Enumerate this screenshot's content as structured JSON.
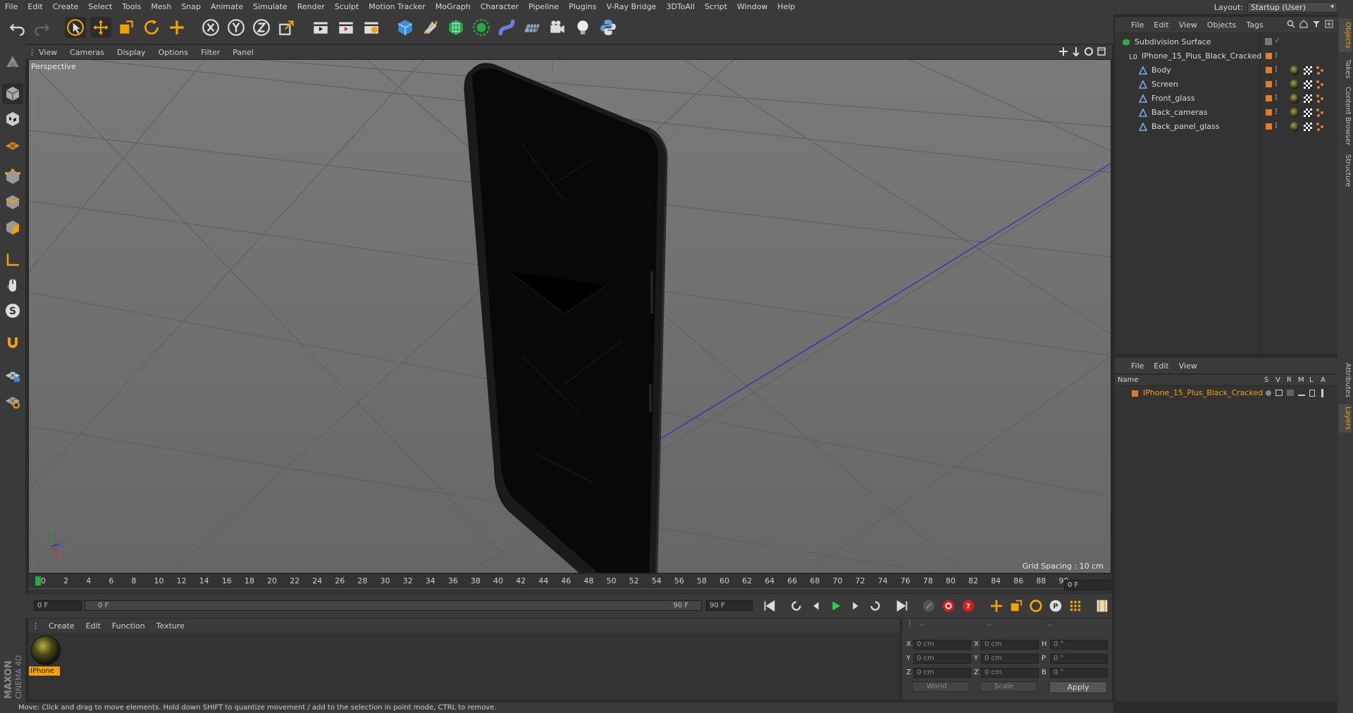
{
  "menubar": {
    "items": [
      "File",
      "Edit",
      "Create",
      "Select",
      "Tools",
      "Mesh",
      "Snap",
      "Animate",
      "Simulate",
      "Render",
      "Sculpt",
      "Motion Tracker",
      "MoGraph",
      "Character",
      "Pipeline",
      "Plugins",
      "V-Ray Bridge",
      "3DToAll",
      "Script",
      "Window",
      "Help"
    ],
    "layout_label": "Layout:",
    "layout_value": "Startup (User)"
  },
  "viewport": {
    "menu": [
      "View",
      "Cameras",
      "Display",
      "Options",
      "Filter",
      "Panel"
    ],
    "label": "Perspective",
    "grid_spacing": "Grid Spacing : 10 cm",
    "axis_y": "Y",
    "axis_z": "Z",
    "axis_x": "X"
  },
  "timeline": {
    "ticks": [
      "0",
      "2",
      "4",
      "6",
      "8",
      "10",
      "12",
      "14",
      "16",
      "18",
      "20",
      "22",
      "24",
      "26",
      "28",
      "30",
      "32",
      "34",
      "36",
      "38",
      "40",
      "42",
      "44",
      "46",
      "48",
      "50",
      "52",
      "54",
      "56",
      "58",
      "60",
      "62",
      "64",
      "66",
      "68",
      "70",
      "72",
      "74",
      "76",
      "78",
      "80",
      "82",
      "84",
      "86",
      "88",
      "90"
    ],
    "current_frame": "0 F"
  },
  "transport": {
    "start_field": "0 F",
    "range_start": "0 F",
    "range_end": "90 F",
    "end_field": "90 F"
  },
  "material_manager": {
    "menu": [
      "Create",
      "Edit",
      "Function",
      "Texture"
    ],
    "material_name": "IPhone"
  },
  "coordinates": {
    "header_left": "--",
    "header_mid": "--",
    "header_right": "--",
    "rows": [
      {
        "l1": "X",
        "v1": "0 cm",
        "l2": "X",
        "v2": "0 cm",
        "l3": "H",
        "v3": "0 °"
      },
      {
        "l1": "Y",
        "v1": "0 cm",
        "l2": "Y",
        "v2": "0 cm",
        "l3": "P",
        "v3": "0 °"
      },
      {
        "l1": "Z",
        "v1": "0 cm",
        "l2": "Z",
        "v2": "0 cm",
        "l3": "B",
        "v3": "0 °"
      }
    ],
    "mode_world": "World",
    "mode_scale": "Scale",
    "apply": "Apply"
  },
  "status": "Move: Click and drag to move elements. Hold down SHIFT to quantize movement / add to the selection in point mode, CTRL to remove.",
  "object_manager": {
    "menu": [
      "File",
      "Edit",
      "View",
      "Objects",
      "Tags"
    ],
    "objects": [
      {
        "name": "Subdivision Surface",
        "level": 0
      },
      {
        "name": "IPhone_15_Plus_Black_Cracked",
        "level": 1
      },
      {
        "name": "Body",
        "level": 2
      },
      {
        "name": "Screen",
        "level": 2
      },
      {
        "name": "Front_glass",
        "level": 2
      },
      {
        "name": "Back_cameras",
        "level": 2
      },
      {
        "name": "Back_panel_glass",
        "level": 2
      }
    ]
  },
  "layer_manager": {
    "menu": [
      "File",
      "Edit",
      "View"
    ],
    "header_name": "Name",
    "header_cols": [
      "S",
      "V",
      "R",
      "M",
      "L",
      "A"
    ],
    "layer_name": "IPhone_15_Plus_Black_Cracked"
  },
  "right_tabs": [
    "Objects",
    "Takes",
    "Content Browser",
    "Structure",
    "Attributes",
    "Layers"
  ],
  "brand": {
    "line1": "MAXON",
    "line2": "CINEMA 4D"
  },
  "colors": {
    "accent": "#f2a100",
    "layer_orange": "#e57a2a",
    "axis_blue": "#2a2acc"
  }
}
